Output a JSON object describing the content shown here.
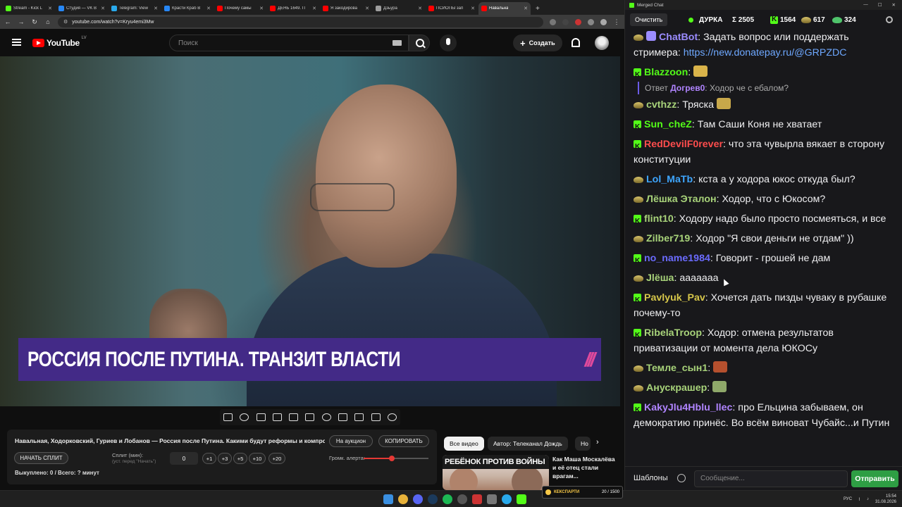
{
  "browser": {
    "tabs": [
      {
        "label": "Stream - Kick L",
        "color": "#53fc18",
        "active": false
      },
      {
        "label": "Студия — VK В",
        "color": "#2787f5",
        "active": false
      },
      {
        "label": "Telegram: View",
        "color": "#29a9eb",
        "active": false
      },
      {
        "label": "Красти Краб В",
        "color": "#2787f5",
        "active": false
      },
      {
        "label": "Почему самы",
        "color": "#ff0000",
        "active": false
      },
      {
        "label": "ДЕНЬ 1649. П",
        "color": "#ff0000",
        "active": false
      },
      {
        "label": "Я закодирова",
        "color": "#ff0000",
        "active": false
      },
      {
        "label": "Дзьyра",
        "color": "#9e9e9e",
        "active": false
      },
      {
        "label": "ПСИОПЫ зап",
        "color": "#ff0000",
        "active": false
      },
      {
        "label": "Навальна",
        "color": "#ff0000",
        "active": true
      }
    ],
    "new_tab": "+",
    "url": "youtube.com/watch?v=Kryu4emi3Mw",
    "window_controls": [
      "—",
      "☐",
      "✕"
    ]
  },
  "youtube": {
    "logo_text": "YouTube",
    "region": "LV",
    "search_placeholder": "Поиск",
    "create_label": "Создать",
    "video_overlay_title": "РОССИЯ ПОСЛЕ ПУТИНА. ТРАНЗИТ ВЛАСТИ",
    "overlay_logo": "///"
  },
  "extension_panel": {
    "video_title": "Навальная, Ходорковский, Гуриев и Лобанов — Россия после Путина. Какими будут реформы и компро...",
    "auction_btn": "На аукцион",
    "copy_btn": "КОПИРОВАТЬ",
    "start_split_btn": "НАЧАТЬ СПЛИТ",
    "split_label": "Сплит (мин):",
    "split_hint": "(уст. перед \"Начать\")",
    "split_value": "0",
    "increments": [
      "+1",
      "+3",
      "+5",
      "+10",
      "+20"
    ],
    "volume_label": "Громк. алерта:",
    "volume_level": 0.43,
    "progress_text": "Выкуплено: 0 / Всего: ? минут"
  },
  "related": {
    "chips": [
      "Все видео",
      "Автор: Телеканал Дождь",
      "Но"
    ],
    "thumb_banner": "РЕБЁНОК ПРОТИВ ВОЙНЫ",
    "title": "Как Маша Москалёва и её отец стали врагам..."
  },
  "chat": {
    "window_title": "Merged Chat",
    "clear_btn": "Очистить",
    "streamer": "ДУРКА",
    "total": "Σ 2505",
    "kick_count": "1564",
    "other_count": "617",
    "third_count": "324",
    "messages": [
      {
        "platform": "other",
        "user": "ChatBot",
        "color": "#9b8cff",
        "bot": true,
        "text": "Задать вопрос или поддержать стримера: ",
        "link": "https://new.donatepay.ru/@GRPZDC"
      },
      {
        "platform": "kick",
        "user": "Blazzoon",
        "color": "#53fc18",
        "text": "",
        "emote": "#d9b34a"
      },
      {
        "reply": true,
        "reply_prefix": "Ответ",
        "reply_user": "Догрев0",
        "reply_text": "Ходор че с ебалом?"
      },
      {
        "platform": "other",
        "user": "cvthzz",
        "color": "#a8d37a",
        "text": "Тряска",
        "emote": "#c8a84a"
      },
      {
        "platform": "kick",
        "user": "Sun_cheZ",
        "color": "#53fc18",
        "text": "Там Саши Коня не хватает"
      },
      {
        "platform": "kick",
        "user": "RedDevilF0rever",
        "color": "#ff4d4d",
        "text": "что эта чувырла вякает в сторону конституции"
      },
      {
        "platform": "other",
        "user": "Lol_MaTb",
        "color": "#3ea6ff",
        "text": "кста а у ходора юкос откуда был?"
      },
      {
        "platform": "other",
        "user": "Лёшка Эталон",
        "color": "#a8d37a",
        "text": "Ходор, что с Юкосом?"
      },
      {
        "platform": "kick",
        "user": "flint10",
        "color": "#a8d37a",
        "text": "Ходору надо было просто посмеяться, и все"
      },
      {
        "platform": "other",
        "user": "Zilber719",
        "color": "#a8d37a",
        "text": "Ходор \"Я свои деньги не отдам\" ))"
      },
      {
        "platform": "kick",
        "user": "no_name1984",
        "color": "#6b6bff",
        "text": "Говорит - грошей не дам"
      },
      {
        "platform": "other",
        "user": "Jlёша",
        "color": "#a8d37a",
        "text": "ааааааа"
      },
      {
        "platform": "kick",
        "user": "Pavlyuk_Pav",
        "color": "#d6c64a",
        "text": "Хочется дать пизды чуваку в рубашке почему-то"
      },
      {
        "platform": "kick",
        "user": "RibelaTroop",
        "color": "#a8d37a",
        "text": "Ходор: отмена результатов приватизации от момента дела ЮКОСу"
      },
      {
        "platform": "other",
        "user": "Темле_сын1",
        "color": "#a8d37a",
        "text": "",
        "emote": "#b5502e"
      },
      {
        "platform": "other",
        "user": "Анускрашер",
        "color": "#a8d37a",
        "text": "",
        "emote": "#8fa86a"
      },
      {
        "platform": "kick",
        "user": "KakyJlu4Hblu_llec",
        "color": "#b084ff",
        "text": "про Ельцина забываем, он демократию принёс. Во всём виноват Чубайс...и Путин"
      }
    ],
    "templates_btn": "Шаблоны",
    "input_placeholder": "Сообщение...",
    "send_btn": "Отправить"
  },
  "taskbar": {
    "lang": "РУС",
    "time": "15:54",
    "date": "31.08.2026",
    "overlay_label": "КЕКСПАРТИ",
    "overlay_value": "20 / 1500"
  },
  "colors": {
    "kick_green": "#53fc18",
    "lower_third": "#432a87",
    "send_green": "#2e9e44"
  }
}
